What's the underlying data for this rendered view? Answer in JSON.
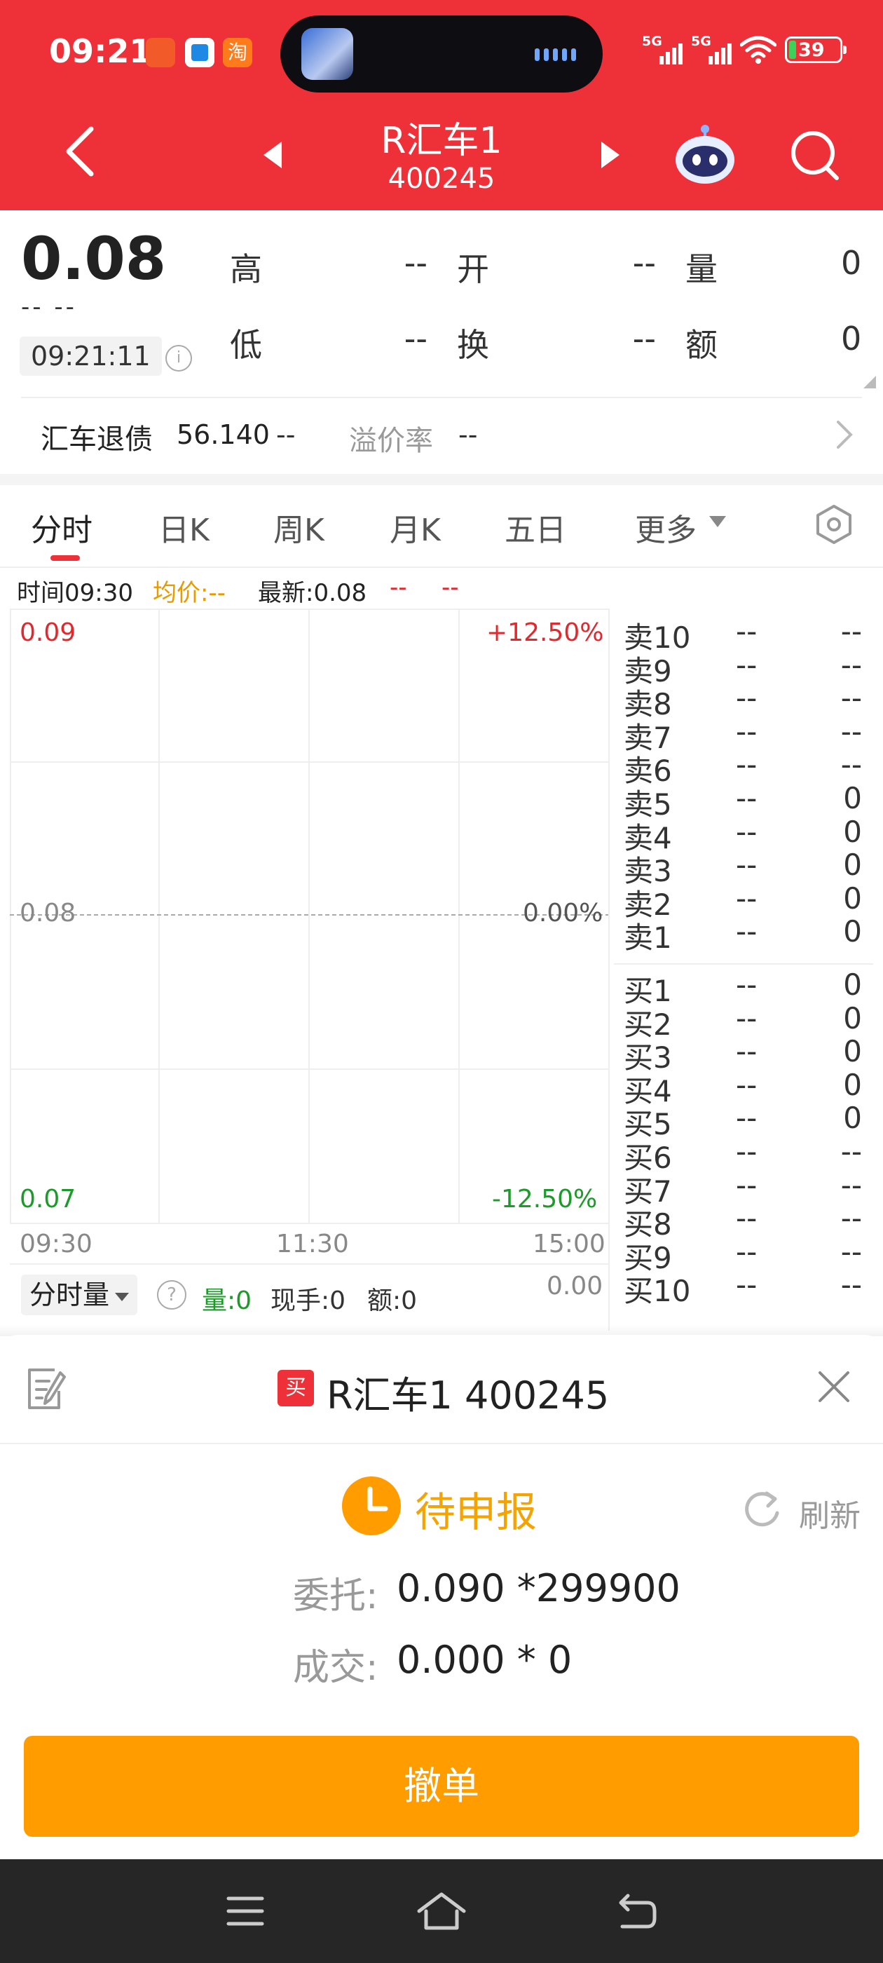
{
  "status_bar": {
    "time": "09:21",
    "notif_taobao": "淘",
    "signal1_label": "5G",
    "signal2_label": "5G",
    "battery": "39"
  },
  "nav": {
    "title": "R汇车1",
    "code": "400245"
  },
  "quote": {
    "last_price": "0.08",
    "change_placeholder": "-- --",
    "time": "09:21:11",
    "fields": [
      {
        "label": "高",
        "value": "--"
      },
      {
        "label": "开",
        "value": "--"
      },
      {
        "label": "量",
        "value": "0"
      },
      {
        "label": "低",
        "value": "--"
      },
      {
        "label": "换",
        "value": "--"
      },
      {
        "label": "额",
        "value": "0"
      }
    ],
    "bond_label": "汇车退债",
    "bond_price": "56.140",
    "bond_change": "--",
    "premium_label": "溢价率",
    "premium_value": "--"
  },
  "tabs": [
    {
      "label": "分时",
      "active": true
    },
    {
      "label": "日K"
    },
    {
      "label": "周K"
    },
    {
      "label": "月K"
    },
    {
      "label": "五日"
    },
    {
      "label": "更多"
    }
  ],
  "legend": {
    "time": "时间09:30",
    "avg": "均价:--",
    "latest": "最新:0.08",
    "change": "--",
    "change_pct": "--"
  },
  "chart": {
    "price_top": "0.09",
    "price_mid": "0.08",
    "price_bottom": "0.07",
    "pct_top": "+12.50%",
    "pct_mid": "0.00%",
    "pct_bottom": "-12.50%",
    "time_start": "09:30",
    "time_mid": "11:30",
    "time_end": "15:00",
    "colors": {
      "up": "#E0292F",
      "down": "#1C9A2A",
      "flat": "#777777"
    }
  },
  "order_book": {
    "asks": [
      {
        "level": "卖10",
        "price": "--",
        "volume": "--"
      },
      {
        "level": "卖9",
        "price": "--",
        "volume": "--"
      },
      {
        "level": "卖8",
        "price": "--",
        "volume": "--"
      },
      {
        "level": "卖7",
        "price": "--",
        "volume": "--"
      },
      {
        "level": "卖6",
        "price": "--",
        "volume": "--"
      },
      {
        "level": "卖5",
        "price": "--",
        "volume": "0"
      },
      {
        "level": "卖4",
        "price": "--",
        "volume": "0"
      },
      {
        "level": "卖3",
        "price": "--",
        "volume": "0"
      },
      {
        "level": "卖2",
        "price": "--",
        "volume": "0"
      },
      {
        "level": "卖1",
        "price": "--",
        "volume": "0"
      }
    ],
    "bids": [
      {
        "level": "买1",
        "price": "--",
        "volume": "0"
      },
      {
        "level": "买2",
        "price": "--",
        "volume": "0"
      },
      {
        "level": "买3",
        "price": "--",
        "volume": "0"
      },
      {
        "level": "买4",
        "price": "--",
        "volume": "0"
      },
      {
        "level": "买5",
        "price": "--",
        "volume": "0"
      },
      {
        "level": "买6",
        "price": "--",
        "volume": "--"
      },
      {
        "level": "买7",
        "price": "--",
        "volume": "--"
      },
      {
        "level": "买8",
        "price": "--",
        "volume": "--"
      },
      {
        "level": "买9",
        "price": "--",
        "volume": "--"
      },
      {
        "level": "买10",
        "price": "--",
        "volume": "--"
      }
    ]
  },
  "volume_bar": {
    "select_label": "分时量",
    "qty": "量:0",
    "hand": "现手:0",
    "amount": "额:0",
    "axis_value": "0.00"
  },
  "order_sheet": {
    "side_badge": "买",
    "title": "R汇车1 400245",
    "status": "待申报",
    "refresh": "刷新",
    "entrust_label": "委托:",
    "entrust_value": "0.090 *299900",
    "deal_label": "成交:",
    "deal_value": "0.000 * 0",
    "cancel_button": "撤单"
  },
  "icons": {
    "back": "back-arrow-icon",
    "prev": "prev-stock-icon",
    "next": "next-stock-icon",
    "assistant": "robot-assistant-icon",
    "search": "search-icon",
    "settings": "hexagon-settings-icon",
    "edit": "edit-note-icon",
    "close": "close-icon",
    "status": "clock-icon",
    "refresh": "refresh-icon"
  }
}
